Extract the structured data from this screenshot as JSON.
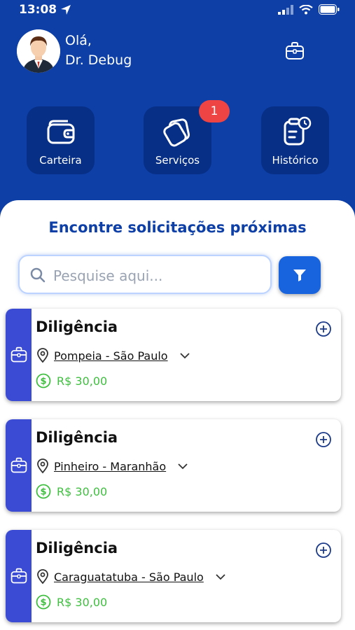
{
  "status": {
    "time": "13:08"
  },
  "header": {
    "greeting": "Olá,",
    "name": "Dr. Debug"
  },
  "tiles": [
    {
      "label": "Carteira",
      "icon": "wallet-icon"
    },
    {
      "label": "Serviços",
      "icon": "cards-icon",
      "badge": "1"
    },
    {
      "label": "Histórico",
      "icon": "clipboard-clock-icon"
    }
  ],
  "main": {
    "title": "Encontre solicitações próximas",
    "search_placeholder": "Pesquise aqui..."
  },
  "cards": [
    {
      "title": "Diligência",
      "location": "Pompeia - São Paulo",
      "price": "R$ 30,00"
    },
    {
      "title": "Diligência",
      "location": "Pinheiro - Maranhão",
      "price": "R$ 30,00"
    },
    {
      "title": "Diligência",
      "location": "Caraguatatuba - São Paulo",
      "price": "R$ 30,00"
    }
  ],
  "colors": {
    "primary": "#0d3fa6",
    "accent": "#1864df",
    "stripe": "#3b4bd3",
    "price": "#3fbf3f",
    "badge": "#ef4444"
  }
}
